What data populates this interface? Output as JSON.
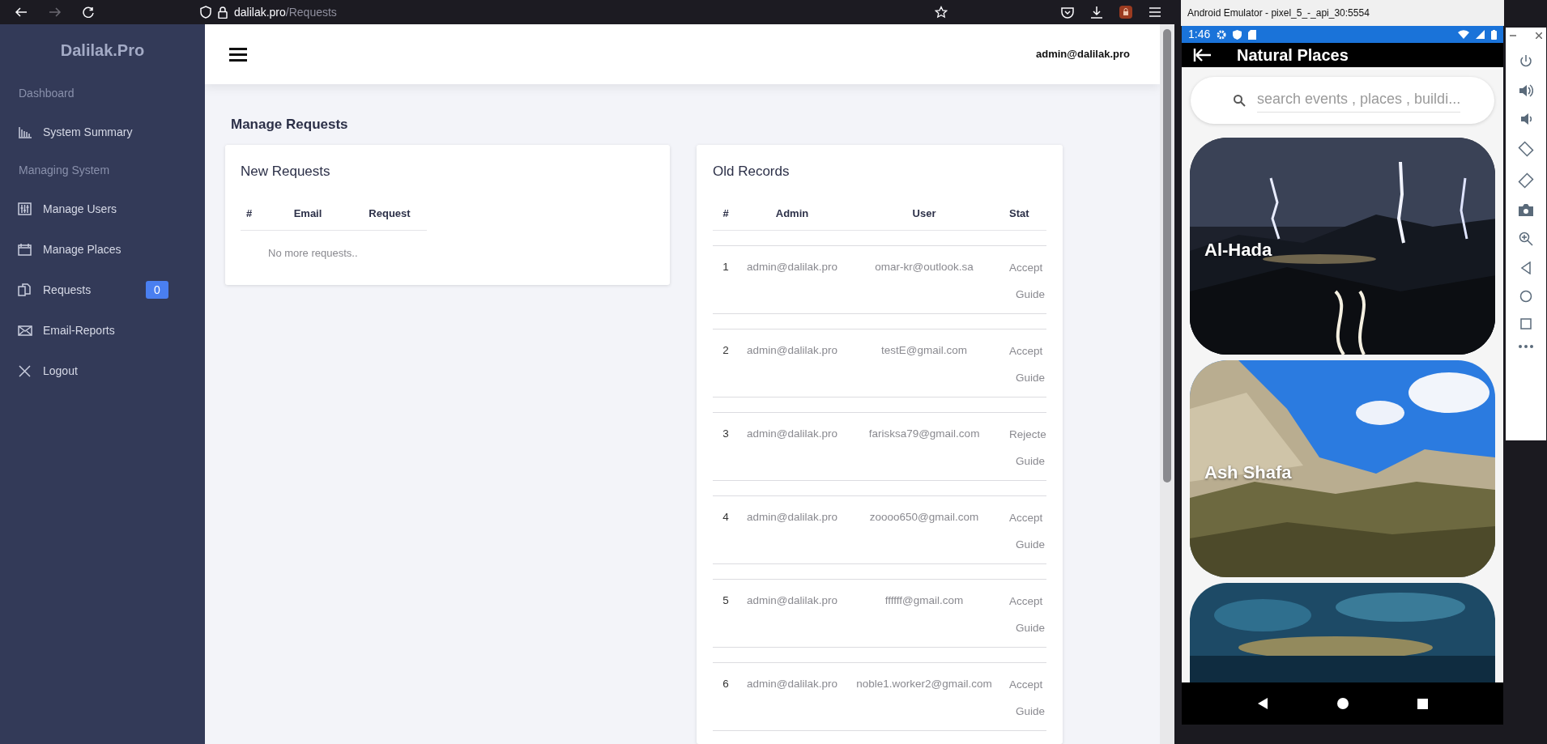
{
  "browser": {
    "url_host": "dalilak.pro",
    "url_path": "/Requests"
  },
  "sidebar": {
    "brand": "Dalilak.Pro",
    "items": [
      {
        "kind": "heading",
        "label": "Dashboard"
      },
      {
        "kind": "link",
        "label": "System Summary"
      },
      {
        "kind": "heading",
        "label": "Managing System"
      },
      {
        "kind": "link",
        "label": "Manage Users"
      },
      {
        "kind": "link",
        "label": "Manage Places"
      },
      {
        "kind": "link",
        "label": "Requests",
        "badge": "0"
      },
      {
        "kind": "link",
        "label": "Email-Reports"
      },
      {
        "kind": "link",
        "label": "Logout"
      }
    ]
  },
  "header": {
    "account": "admin@dalilak.pro"
  },
  "page_title": "Manage Requests",
  "new_requests": {
    "title": "New Requests",
    "columns": [
      "#",
      "Email",
      "Request"
    ],
    "empty_message": "No more requests.."
  },
  "old_records": {
    "title": "Old Records",
    "columns": [
      "#",
      "Admin",
      "User",
      "Stat"
    ],
    "rows": [
      {
        "number": "1",
        "admin": "admin@dalilak.pro",
        "user": "omar-kr@outlook.sa",
        "status": "Accept",
        "detail": "Guide"
      },
      {
        "number": "2",
        "admin": "admin@dalilak.pro",
        "user": "testE@gmail.com",
        "status": "Accept",
        "detail": "Guide"
      },
      {
        "number": "3",
        "admin": "admin@dalilak.pro",
        "user": "farisksa79@gmail.com",
        "status": "Rejecte",
        "detail": "Guide"
      },
      {
        "number": "4",
        "admin": "admin@dalilak.pro",
        "user": "zoooo650@gmail.com",
        "status": "Accept",
        "detail": "Guide"
      },
      {
        "number": "5",
        "admin": "admin@dalilak.pro",
        "user": "ffffff@gmail.com",
        "status": "Accept",
        "detail": "Guide"
      },
      {
        "number": "6",
        "admin": "admin@dalilak.pro",
        "user": "noble1.worker2@gmail.com",
        "status": "Accept",
        "detail": "Guide"
      }
    ]
  },
  "emulator": {
    "title": "Android Emulator - pixel_5_-_api_30:5554",
    "time": "1:46",
    "app_title": "Natural Places",
    "search_placeholder": "search events , places , buildi...",
    "places": [
      {
        "kind": "picture",
        "name": "Al-Hada"
      },
      {
        "kind": "picture",
        "name": "Ash Shafa"
      },
      {
        "kind": "picture"
      }
    ]
  }
}
